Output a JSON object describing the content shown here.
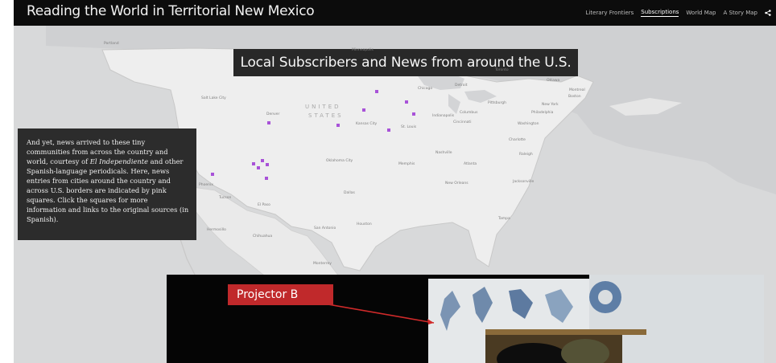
{
  "header": {
    "title": "Reading the World in Territorial New Mexico",
    "nav": [
      {
        "label": "Literary Frontiers",
        "active": false
      },
      {
        "label": "Subscriptions",
        "active": true
      },
      {
        "label": "World Map",
        "active": false
      },
      {
        "label": "A Story Map",
        "active": false
      }
    ],
    "share_icon": "share-icon"
  },
  "map": {
    "title": "Local Subscribers and News from around the U.S.",
    "marker_color": "#a852d8",
    "country_label": "UNITED STATES",
    "country_label_line1": "UNITED",
    "country_label_line2": "STATES",
    "cities": [
      "Portland",
      "Salt Lake City",
      "Denver",
      "Kansas City",
      "St. Louis",
      "Chicago",
      "Detroit",
      "Toronto",
      "Ottawa",
      "Montreal",
      "Boston",
      "New York",
      "Philadelphia",
      "Washington",
      "Indianapolis",
      "Columbus",
      "Cincinnati",
      "Pittsburgh",
      "Nashville",
      "Memphis",
      "Atlanta",
      "Charlotte",
      "Oklahoma City",
      "Dallas",
      "Houston",
      "San Antonio",
      "El Paso",
      "Phoenix",
      "Tucson",
      "Hermosillo",
      "Chihuahua",
      "Monterrey",
      "New Orleans",
      "Jacksonville",
      "Tampa",
      "Minneapolis",
      "Raleigh"
    ]
  },
  "caption": {
    "text_before": "And yet, news arrived to these tiny communities from across the country and world, courtesy of ",
    "emphasis": "El Independiente",
    "text_after": " and other Spanish-language periodicals. Here, news entries from cities around the country and across U.S. borders are indicated by pink squares. Click the squares for more information and links to the original sources (in Spanish)."
  },
  "overlay": {
    "label": "Projector B"
  }
}
